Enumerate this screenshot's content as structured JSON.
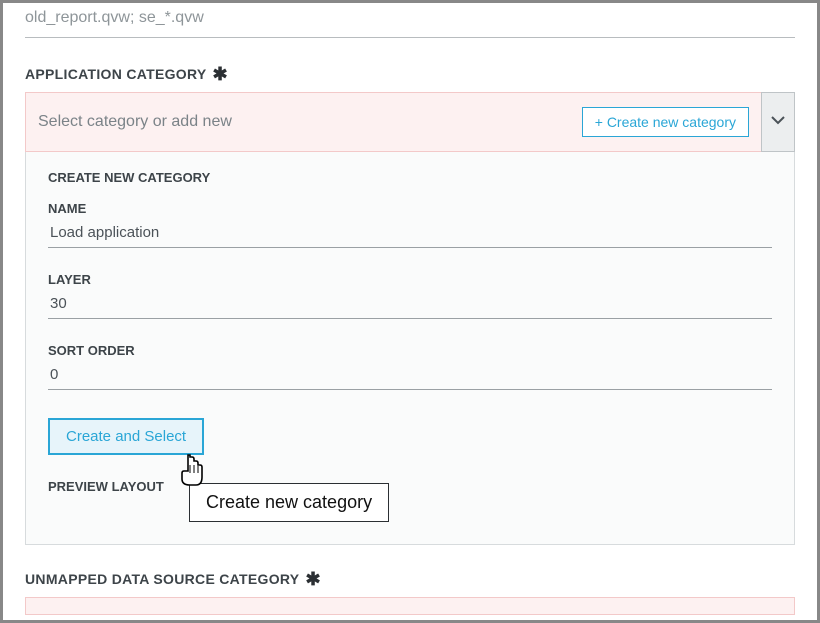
{
  "top_filter": {
    "placeholder": "old_report.qvw; se_*.qvw"
  },
  "app_category": {
    "header": "APPLICATION CATEGORY",
    "select_placeholder": "Select category or add new",
    "create_btn": "+ Create new category"
  },
  "create_panel": {
    "title": "CREATE NEW CATEGORY",
    "name_label": "NAME",
    "name_value": "Load application",
    "layer_label": "LAYER",
    "layer_value": "30",
    "sort_label": "SORT ORDER",
    "sort_value": "0",
    "create_select_btn": "Create and Select",
    "preview_label": "PREVIEW LAYOUT"
  },
  "tooltip": "Create new category",
  "unmapped": {
    "header": "UNMAPPED DATA SOURCE CATEGORY"
  }
}
